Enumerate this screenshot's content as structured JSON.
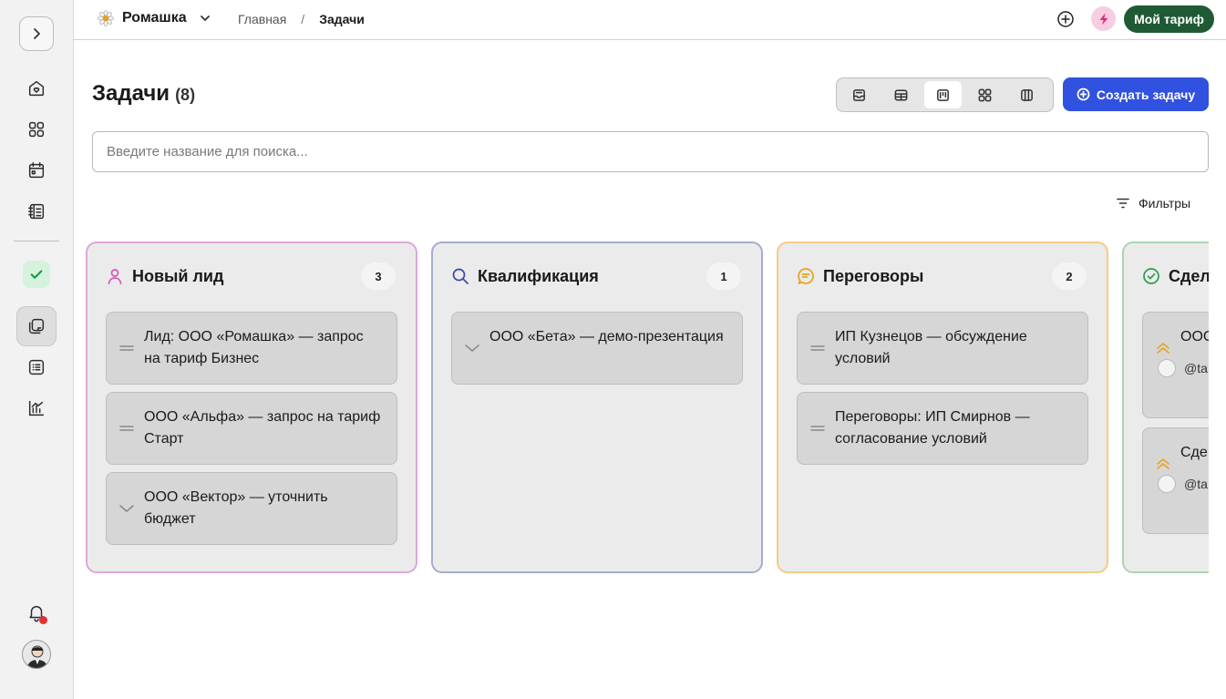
{
  "sidebar": {
    "items": [
      {
        "name": "home-icon"
      },
      {
        "name": "apps-grid-icon"
      },
      {
        "name": "calendar-icon"
      },
      {
        "name": "contacts-book-icon"
      },
      {
        "name": "tasks-check-icon"
      },
      {
        "name": "notes-icon"
      },
      {
        "name": "list-icon"
      },
      {
        "name": "analytics-chart-icon"
      }
    ],
    "active": "notes-icon"
  },
  "topbar": {
    "company": "Ромашка",
    "breadcrumb": {
      "home": "Главная",
      "separator": "/",
      "current": "Задачи"
    },
    "plan_label": "Мой тариф",
    "colors": {
      "plan": "#1f5a34",
      "bolt_bg": "#f6cde1",
      "bolt": "#e0307a"
    }
  },
  "header": {
    "title": "Задачи",
    "count": "(8)",
    "create_label": "Создать задачу",
    "accent": "#3151e0",
    "views": [
      "inbox-view-icon",
      "table-view-icon",
      "kanban-view-icon",
      "grid-view-icon",
      "columns-view-icon"
    ],
    "active_view": "kanban-view-icon"
  },
  "search": {
    "placeholder": "Введите название для поиска..."
  },
  "filters": {
    "label": "Фильтры"
  },
  "board": {
    "columns": [
      {
        "title": "Новый лид",
        "count": "3",
        "color": "#e0a6d8",
        "icon": "person-icon",
        "icon_color": "#d45ab6",
        "cards": [
          {
            "text": "Лид: ООО «Ромашка» — запрос на тариф Бизнес",
            "priority": "medium"
          },
          {
            "text": "ООО «Альфа» — запрос на тариф Старт",
            "priority": "medium"
          },
          {
            "text": "ООО «Вектор» — уточнить бюджет",
            "priority": "low"
          }
        ]
      },
      {
        "title": "Квалификация",
        "count": "1",
        "color": "#a6acd0",
        "icon": "search-icon",
        "icon_color": "#3a4aa8",
        "cards": [
          {
            "text": "ООО «Бета» — демо-презентация",
            "priority": "low"
          }
        ]
      },
      {
        "title": "Переговоры",
        "count": "2",
        "color": "#f2cc86",
        "icon": "chat-icon",
        "icon_color": "#e8a21c",
        "cards": [
          {
            "text": "ИП Кузнецов — обсуждение условий",
            "priority": "medium"
          },
          {
            "text": "Переговоры: ИП Смирнов — согласование условий",
            "priority": "medium"
          }
        ]
      },
      {
        "title": "Сдел",
        "count": "",
        "color": "#a8d6b3",
        "icon": "check-circle-icon",
        "icon_color": "#2f9a52",
        "cards": [
          {
            "text": "ООС дого",
            "priority": "high",
            "user": "@ta"
          },
          {
            "text": "Сде под",
            "priority": "high",
            "user": "@ta"
          }
        ]
      }
    ]
  }
}
